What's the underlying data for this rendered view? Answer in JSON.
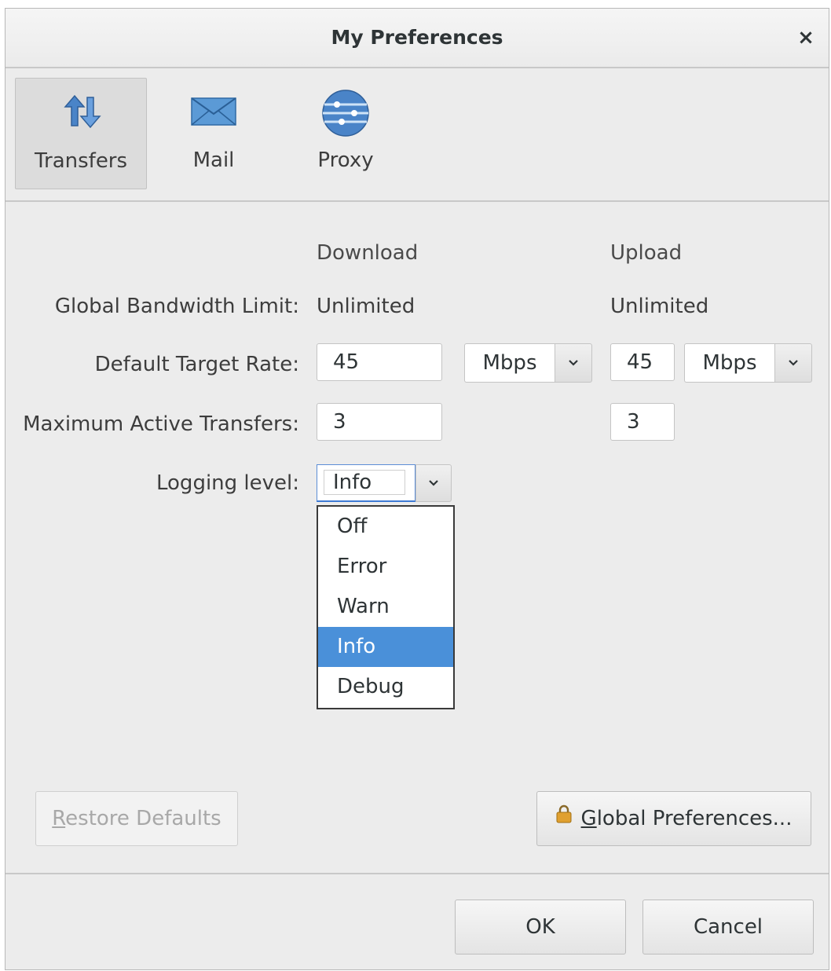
{
  "window": {
    "title": "My Preferences",
    "close_label": "×"
  },
  "toolbar": {
    "tabs": [
      {
        "label": "Transfers",
        "icon": "transfers-icon",
        "active": true
      },
      {
        "label": "Mail",
        "icon": "mail-icon",
        "active": false
      },
      {
        "label": "Proxy",
        "icon": "proxy-icon",
        "active": false
      }
    ]
  },
  "transfers": {
    "columns": {
      "download": "Download",
      "upload": "Upload"
    },
    "global_bandwidth": {
      "label": "Global Bandwidth Limit:",
      "download": "Unlimited",
      "upload": "Unlimited"
    },
    "default_target_rate": {
      "label": "Default Target Rate:",
      "download_value": "45",
      "download_unit": "Mbps",
      "upload_value": "45",
      "upload_unit": "Mbps"
    },
    "max_active_transfers": {
      "label": "Maximum Active Transfers:",
      "download": "3",
      "upload": "3"
    },
    "logging_level": {
      "label": "Logging level:",
      "selected": "Info",
      "options": [
        "Off",
        "Error",
        "Warn",
        "Info",
        "Debug"
      ],
      "selected_index": 3
    }
  },
  "buttons": {
    "restore_defaults_mnemonic": "R",
    "restore_defaults_rest": "estore Defaults",
    "global_preferences_mnemonic": "G",
    "global_preferences_rest": "lobal Preferences...",
    "ok": "OK",
    "cancel": "Cancel"
  },
  "colors": {
    "selection": "#4a90d9",
    "dialog_bg": "#ececec"
  }
}
